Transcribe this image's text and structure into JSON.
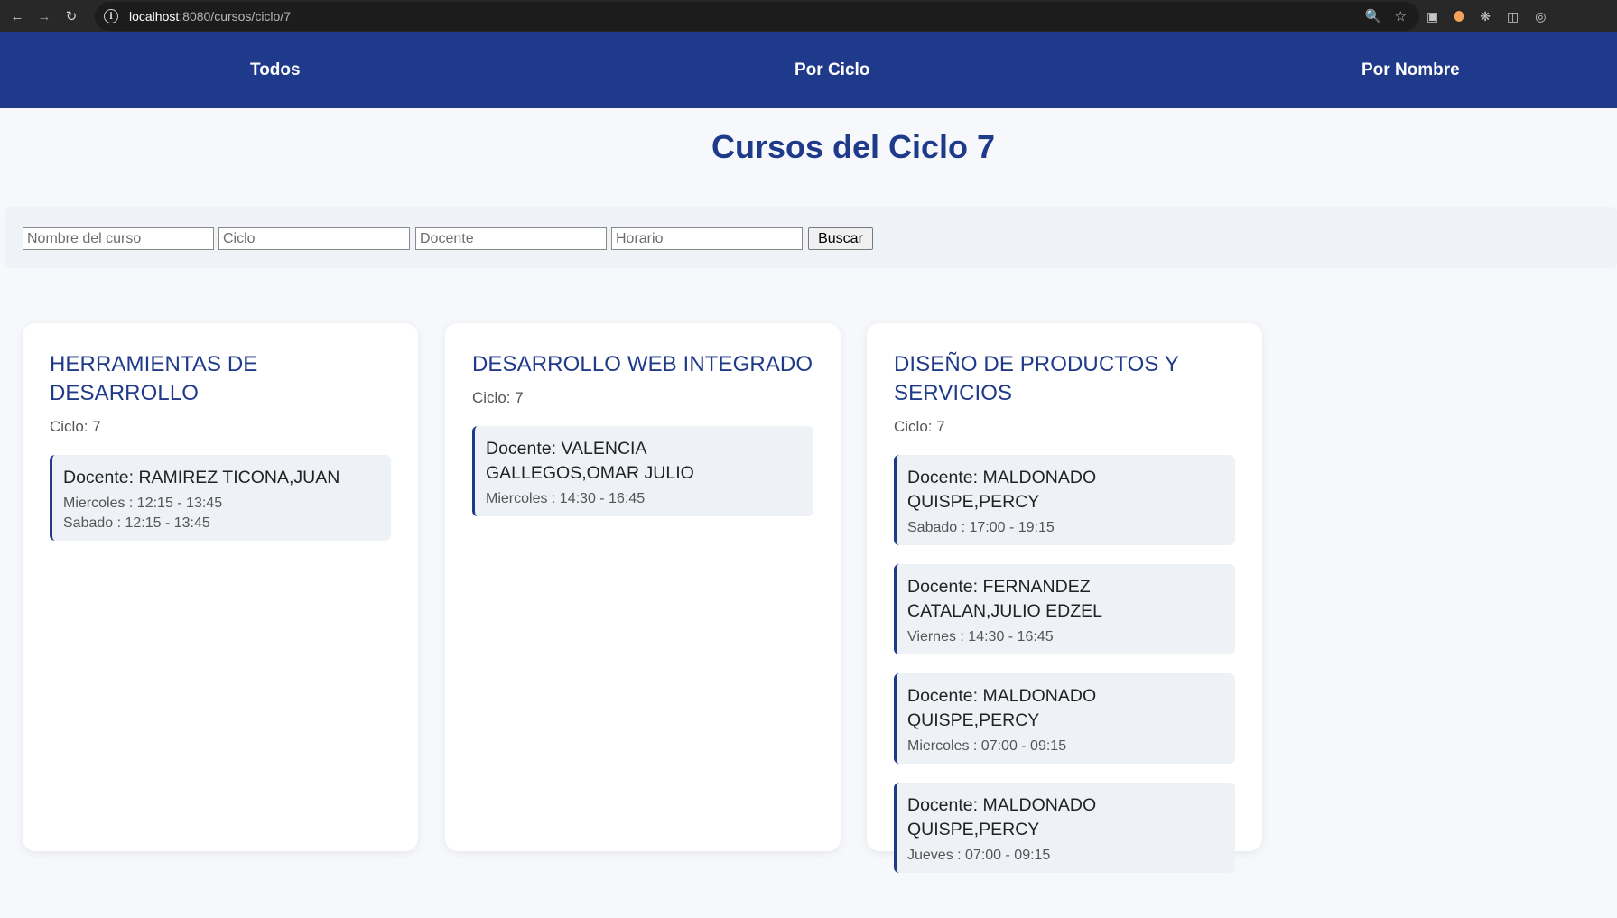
{
  "browser": {
    "url_host": "localhost",
    "url_path": ":8080/cursos/ciclo/7"
  },
  "nav": {
    "items": [
      "Todos",
      "Por Ciclo",
      "Por Nombre"
    ]
  },
  "page": {
    "title": "Cursos del Ciclo 7"
  },
  "search": {
    "nombre_placeholder": "Nombre del curso",
    "ciclo_placeholder": "Ciclo",
    "docente_placeholder": "Docente",
    "horario_placeholder": "Horario",
    "button_label": "Buscar"
  },
  "cursos": [
    {
      "title": "HERRAMIENTAS DE DESARROLLO",
      "ciclo": "Ciclo: 7",
      "sessions": [
        {
          "docente": "Docente: RAMIREZ TICONA,JUAN",
          "times": [
            "Miercoles : 12:15 - 13:45",
            "Sabado : 12:15 - 13:45"
          ]
        }
      ]
    },
    {
      "title": "DESARROLLO WEB INTEGRADO",
      "ciclo": "Ciclo: 7",
      "sessions": [
        {
          "docente": "Docente: VALENCIA GALLEGOS,OMAR JULIO",
          "times": [
            "Miercoles : 14:30 - 16:45"
          ]
        }
      ]
    },
    {
      "title": "DISEÑO DE PRODUCTOS Y SERVICIOS",
      "ciclo": "Ciclo: 7",
      "sessions": [
        {
          "docente": "Docente: MALDONADO QUISPE,PERCY",
          "times": [
            "Sabado : 17:00 - 19:15"
          ]
        },
        {
          "docente": "Docente: FERNANDEZ CATALAN,JULIO EDZEL",
          "times": [
            "Viernes : 14:30 - 16:45"
          ]
        },
        {
          "docente": "Docente: MALDONADO QUISPE,PERCY",
          "times": [
            "Miercoles : 07:00 - 09:15"
          ]
        },
        {
          "docente": "Docente: MALDONADO QUISPE,PERCY",
          "times": [
            "Jueves : 07:00 - 09:15"
          ]
        }
      ]
    }
  ],
  "colors": {
    "primary": "#1f3a8a",
    "background": "#f6f8fc",
    "session_bg": "#eef2f7"
  }
}
